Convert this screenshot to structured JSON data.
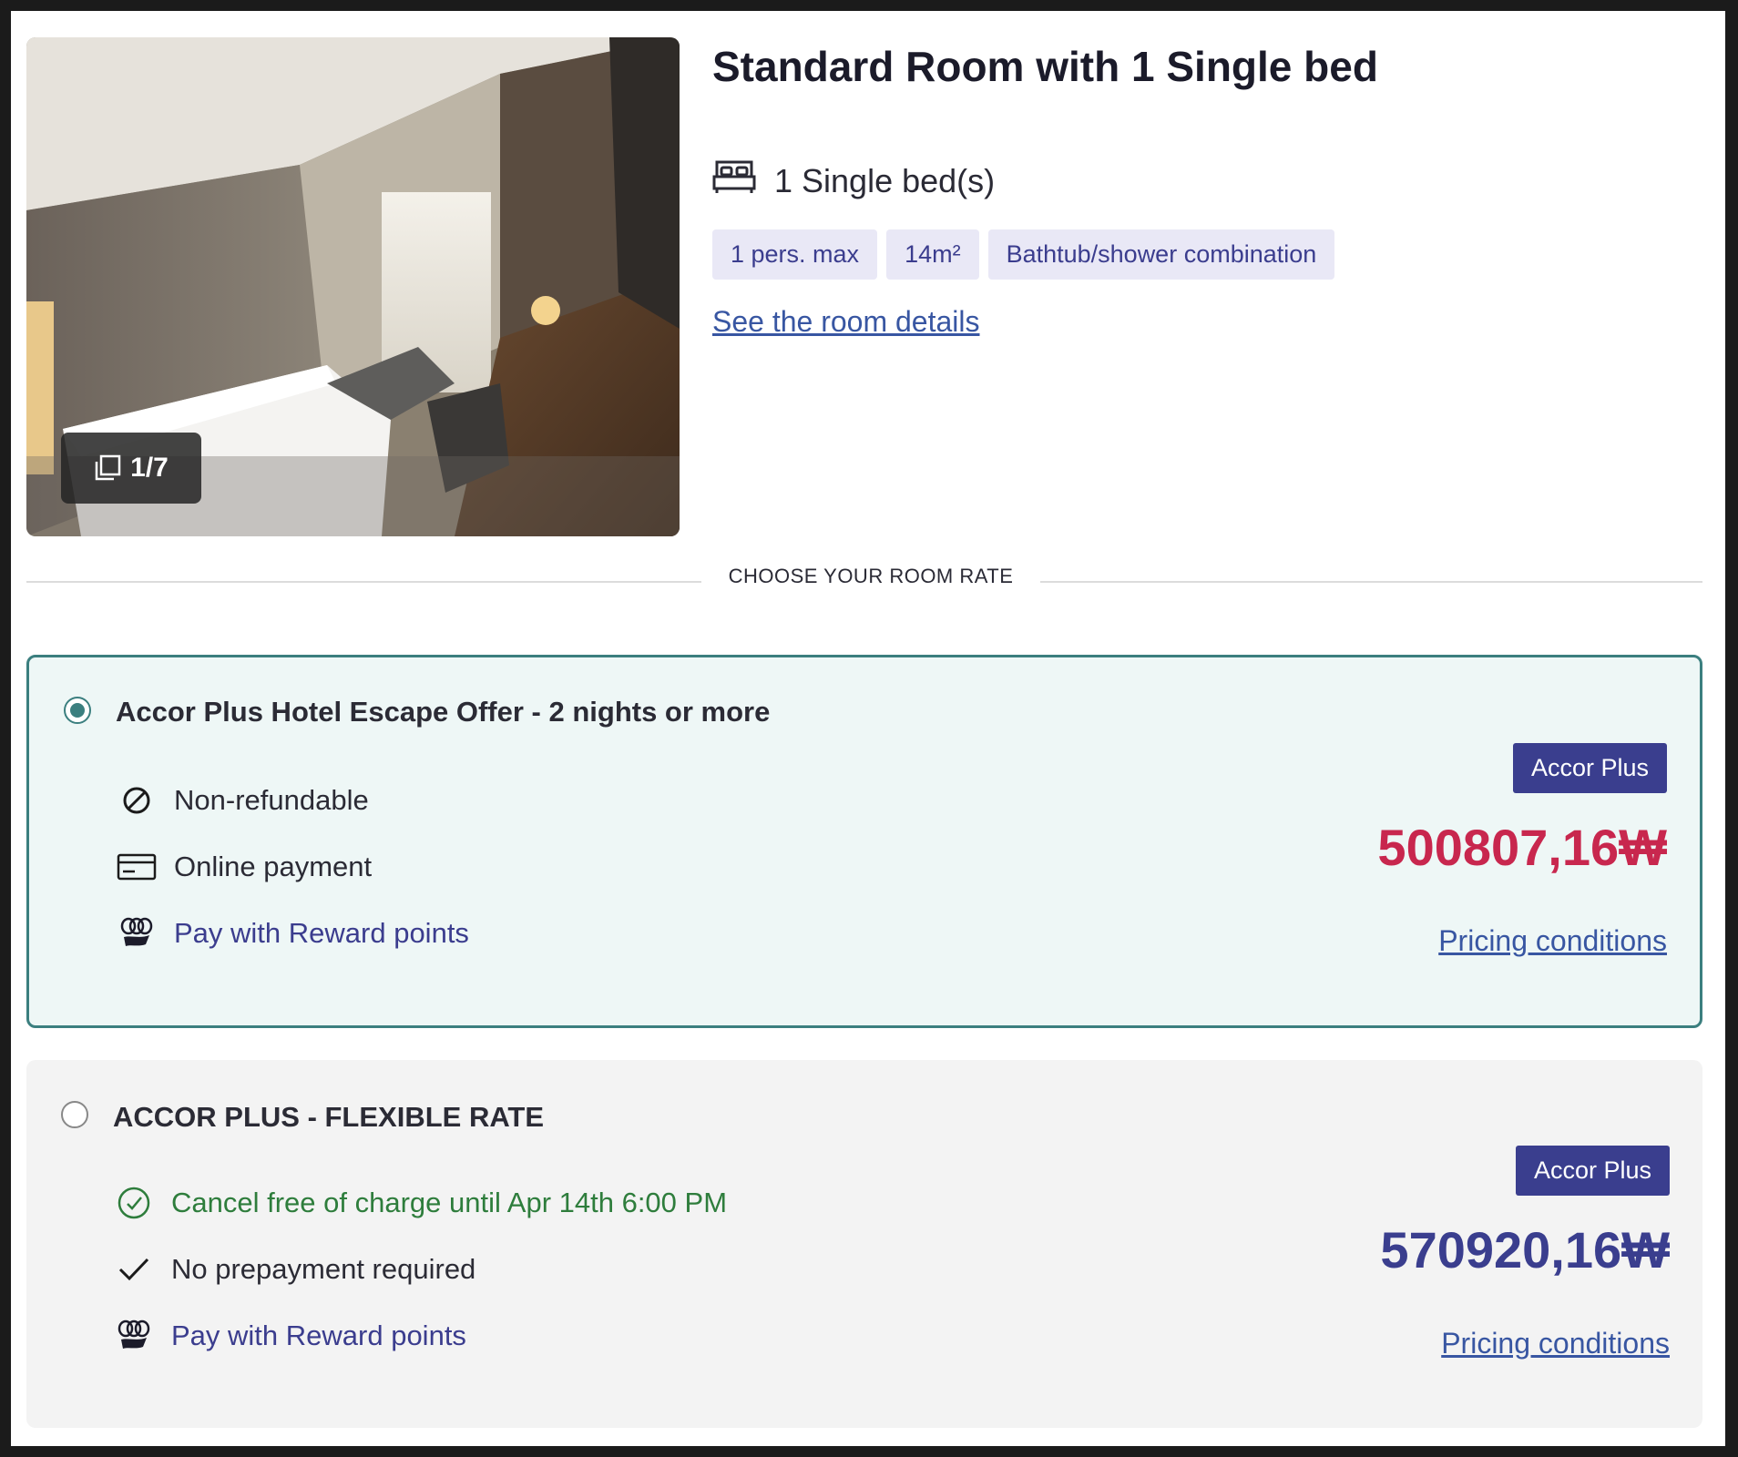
{
  "room": {
    "title": "Standard Room with 1 Single bed",
    "bed": "1 Single bed(s)",
    "tags": [
      "1 pers. max",
      "14m²",
      "Bathtub/shower combination"
    ],
    "details_link": "See the room details",
    "photo_counter": "1/7"
  },
  "rates_header": "CHOOSE YOUR ROOM RATE",
  "rates": [
    {
      "title": "Accor Plus Hotel Escape Offer - 2 nights or more",
      "selected": true,
      "features": [
        "Non-refundable",
        "Online payment",
        "Pay with Reward points"
      ],
      "badge": "Accor Plus",
      "price": "500807,16₩",
      "pricing_link": "Pricing conditions"
    },
    {
      "title": "ACCOR PLUS - FLEXIBLE RATE",
      "selected": false,
      "features": [
        "Cancel free of charge until Apr 14th 6:00 PM",
        "No prepayment required",
        "Pay with Reward points"
      ],
      "badge": "Accor Plus",
      "price": "570920,16₩",
      "pricing_link": "Pricing conditions"
    }
  ],
  "colors": {
    "accent_teal": "#3b7f7f",
    "brand_navy": "#3a3e8e",
    "price_red": "#c8274e",
    "link_blue": "#3856a2",
    "success_green": "#2e7d3c"
  }
}
